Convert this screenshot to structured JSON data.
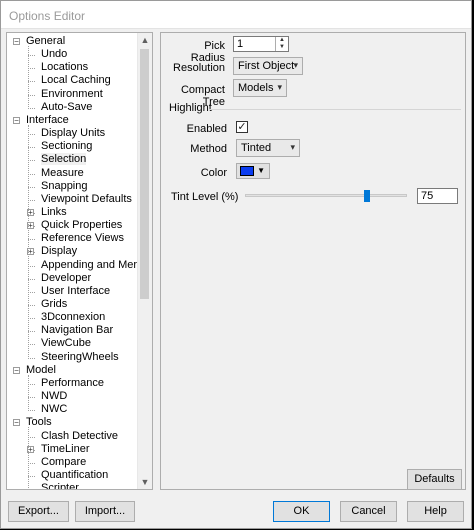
{
  "window": {
    "title": "Options Editor"
  },
  "tree": {
    "rows": [
      {
        "label": "General",
        "level": 0,
        "expander": "minus"
      },
      {
        "label": "Undo",
        "level": 1
      },
      {
        "label": "Locations",
        "level": 1
      },
      {
        "label": "Local Caching",
        "level": 1
      },
      {
        "label": "Environment",
        "level": 1
      },
      {
        "label": "Auto-Save",
        "level": 1
      },
      {
        "label": "Interface",
        "level": 0,
        "expander": "minus"
      },
      {
        "label": "Display Units",
        "level": 1
      },
      {
        "label": "Sectioning",
        "level": 1
      },
      {
        "label": "Selection",
        "level": 1,
        "selected": true
      },
      {
        "label": "Measure",
        "level": 1
      },
      {
        "label": "Snapping",
        "level": 1
      },
      {
        "label": "Viewpoint Defaults",
        "level": 1
      },
      {
        "label": "Links",
        "level": 1,
        "expander": "plus"
      },
      {
        "label": "Quick Properties",
        "level": 1,
        "expander": "plus"
      },
      {
        "label": "Reference Views",
        "level": 1
      },
      {
        "label": "Display",
        "level": 1,
        "expander": "plus"
      },
      {
        "label": "Appending and Merging",
        "level": 1
      },
      {
        "label": "Developer",
        "level": 1
      },
      {
        "label": "User Interface",
        "level": 1
      },
      {
        "label": "Grids",
        "level": 1
      },
      {
        "label": "3Dconnexion",
        "level": 1
      },
      {
        "label": "Navigation Bar",
        "level": 1
      },
      {
        "label": "ViewCube",
        "level": 1
      },
      {
        "label": "SteeringWheels",
        "level": 1
      },
      {
        "label": "Model",
        "level": 0,
        "expander": "minus"
      },
      {
        "label": "Performance",
        "level": 1
      },
      {
        "label": "NWD",
        "level": 1
      },
      {
        "label": "NWC",
        "level": 1
      },
      {
        "label": "Tools",
        "level": 0,
        "expander": "minus"
      },
      {
        "label": "Clash Detective",
        "level": 1
      },
      {
        "label": "TimeLiner",
        "level": 1,
        "expander": "plus"
      },
      {
        "label": "Compare",
        "level": 1
      },
      {
        "label": "Quantification",
        "level": 1
      },
      {
        "label": "Scripter",
        "level": 1
      }
    ]
  },
  "selection_panel": {
    "pick_radius": {
      "label": "Pick Radius",
      "value": "1"
    },
    "resolution": {
      "label": "Resolution",
      "value": "First Object"
    },
    "compact_tree": {
      "label": "Compact Tree",
      "value": "Models"
    },
    "highlight": {
      "heading": "Highlight",
      "enabled": {
        "label": "Enabled",
        "checked": true,
        "mark": "✓"
      },
      "method": {
        "label": "Method",
        "value": "Tinted"
      },
      "color": {
        "label": "Color",
        "value": "#0a3cf0"
      },
      "tint_level": {
        "label": "Tint Level (%)",
        "value": "75",
        "level": 75
      }
    },
    "defaults_label": "Defaults"
  },
  "footer": {
    "export_label": "Export...",
    "import_label": "Import...",
    "ok_label": "OK",
    "cancel_label": "Cancel",
    "help_label": "Help"
  },
  "icons": {
    "expand_minus": "minus-box-icon",
    "expand_plus": "plus-box-icon",
    "dropdown": "chevron-down-icon",
    "scroll_up": "scroll-up-arrow-icon",
    "scroll_down": "scroll-down-arrow-icon"
  }
}
